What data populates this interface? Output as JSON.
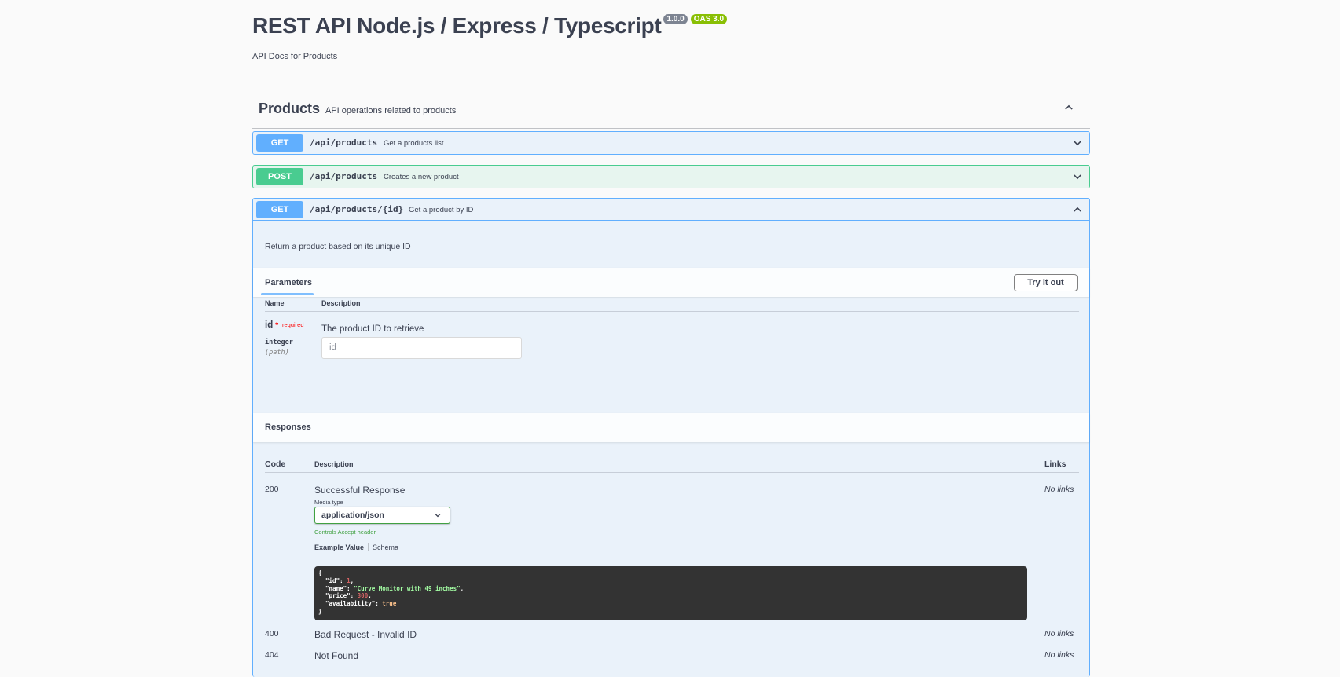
{
  "header": {
    "title": "REST API Node.js / Express / Typescript",
    "version_badge": "1.0.0",
    "oas_badge": "OAS 3.0",
    "subtitle": "API Docs for Products"
  },
  "tag": {
    "name": "Products",
    "description": "API operations related to products",
    "expanded": true
  },
  "operations": [
    {
      "method": "GET",
      "path": "/api/products",
      "summary": "Get a products list",
      "expanded": false
    },
    {
      "method": "POST",
      "path": "/api/products",
      "summary": "Creates a new product",
      "expanded": false
    },
    {
      "method": "GET",
      "path": "/api/products/{id}",
      "summary": "Get a product by ID",
      "expanded": true
    }
  ],
  "detail": {
    "description": "Return a product based on its unique ID",
    "parameters_tab": "Parameters",
    "try_button": "Try it out",
    "param_headers": {
      "name": "Name",
      "description": "Description"
    },
    "param": {
      "name": "id",
      "star": "*",
      "required": "required",
      "type": "integer",
      "in": "(path)",
      "description": "The product ID to retrieve",
      "placeholder": "id"
    },
    "responses_title": "Responses",
    "response_headers": {
      "code": "Code",
      "description": "Description",
      "links": "Links"
    },
    "responses": [
      {
        "code": "200",
        "description": "Successful Response",
        "links": "No links"
      },
      {
        "code": "400",
        "description": "Bad Request - Invalid ID",
        "links": "No links"
      },
      {
        "code": "404",
        "description": "Not Found",
        "links": "No links"
      }
    ],
    "media_type_label": "Media type",
    "media_type_value": "application/json",
    "media_type_note": "Controls Accept header.",
    "example_tab": "Example Value",
    "schema_tab": "Schema",
    "example": {
      "id_key": "\"id\"",
      "id_val": "1",
      "name_key": "\"name\"",
      "name_val": "\"Curve Monitor with 49 inches\"",
      "price_key": "\"price\"",
      "price_val": "300",
      "avail_key": "\"availability\"",
      "avail_val": "true"
    }
  },
  "colors": {
    "get": "#61affe",
    "post": "#49cc90",
    "text": "#3b4151",
    "required": "#ff0000",
    "media_border": "#41a142"
  },
  "icons": {
    "tag_toggle": "chevron-up-icon",
    "op_collapsed": "chevron-down-icon",
    "op_expanded": "chevron-up-icon",
    "select_arrow": "chevron-down-icon"
  }
}
